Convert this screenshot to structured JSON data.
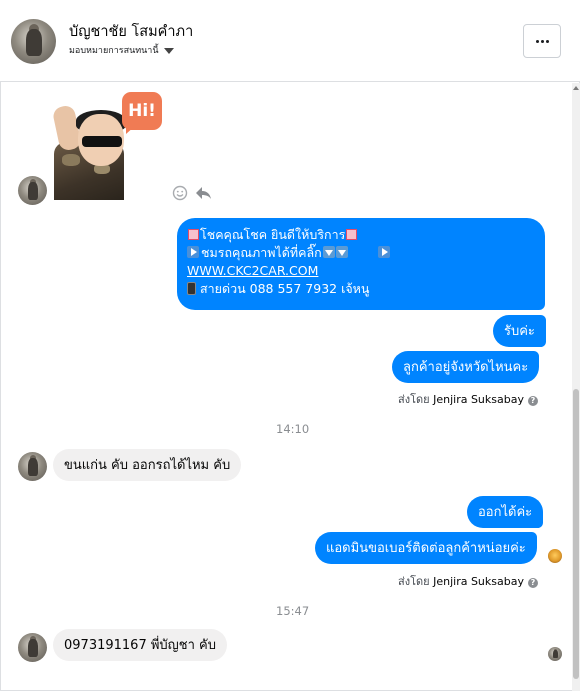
{
  "header": {
    "name": "บัญชาชัย โสมคำภา",
    "subtitle": "มอบหมายการสนทนานี้",
    "more_icon": "more-horizontal-icon"
  },
  "messages": {
    "multi_lines": [
      "โชคคุณโชค ยินดีให้บริการ",
      "ชมรถคุณภาพได้ที่คลิ๊ก",
      "WWW.CKC2CAR.COM",
      "สายด่วน 088 557 7932 เจ้หนู"
    ],
    "m2": "รับค่ะ",
    "m3": "ลูกค้าอยู่จังหวัดไหนคะ",
    "sent_by_prefix": "ส่งโดย",
    "sent_by_name": "Jenjira Suksabay",
    "time1": "14:10",
    "m4": "ขนแก่น คับ ออกรถได้ไหม คับ",
    "m5": "ออกได้ค่ะ",
    "m6": "แอดมินขอเบอร์ติดต่อลูกค้าหน่อยค่ะ",
    "time2": "15:47",
    "m7": "0973191167 พี่บัญชา คับ"
  },
  "sticker": {
    "text": "Hi!"
  },
  "colors": {
    "outgoing": "#0084ff",
    "incoming": "#f1f0f0",
    "timestamp": "#8a8d91"
  }
}
